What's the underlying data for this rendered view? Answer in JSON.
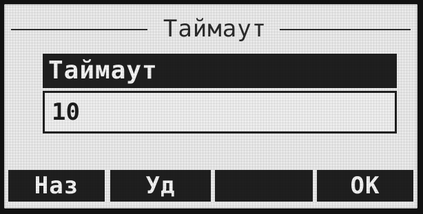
{
  "screen": {
    "title": "Таймаут"
  },
  "field": {
    "label": "Таймаут",
    "value": "10"
  },
  "softkeys": [
    {
      "label": "Наз"
    },
    {
      "label": "Уд"
    },
    {
      "label": ""
    },
    {
      "label": "OK"
    }
  ],
  "colors": {
    "lcd_background": "#e9e9e9",
    "dark_segment": "#1f1f1f",
    "text_dark": "#2a2a2a",
    "text_light": "#f1f1f1"
  }
}
